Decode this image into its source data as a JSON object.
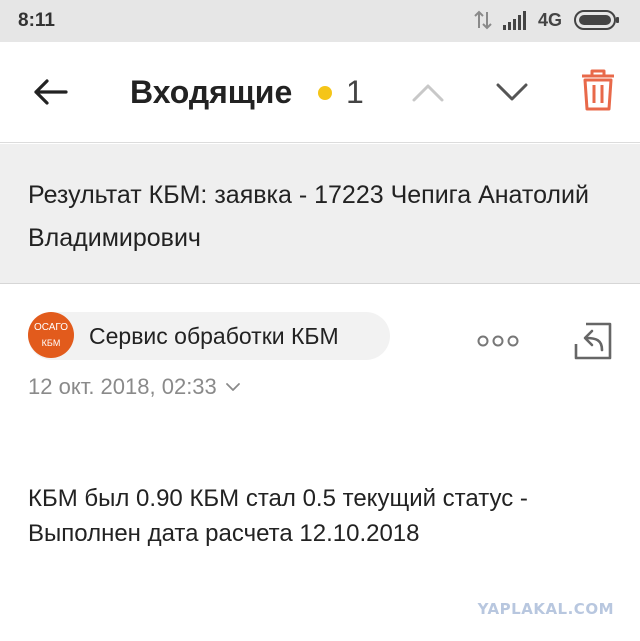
{
  "status_bar": {
    "time": "8:11",
    "network": "4G"
  },
  "toolbar": {
    "title": "Входящие",
    "unread_count": "1",
    "unread_dot_color": "#f5c518",
    "trash_color": "#e8694a"
  },
  "message": {
    "subject": "Результат КБМ: заявка - 17223 Чепига Анатолий Владимирович",
    "sender": {
      "name": "Сервис обработки КБМ",
      "avatar_line1": "ОСАГО",
      "avatar_line2": "КБМ",
      "avatar_color": "#e25b1c"
    },
    "date": "12 окт. 2018, 02:33",
    "body": "КБМ был 0.90 КБМ стал 0.5 текущий статус - Выполнен дата расчета 12.10.2018"
  },
  "watermark": "YAPLAKAL.COM"
}
